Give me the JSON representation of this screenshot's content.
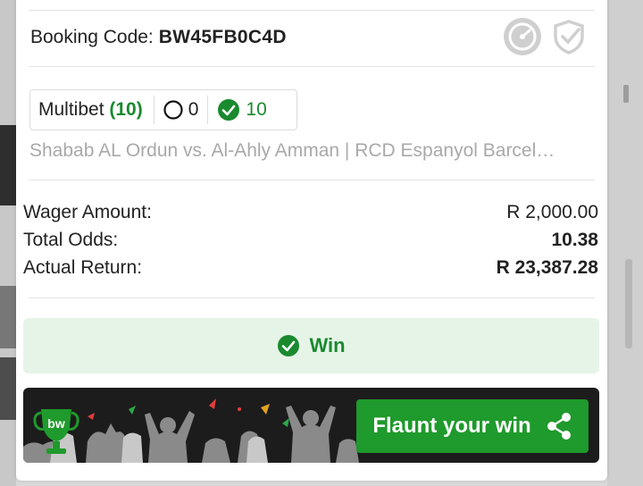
{
  "booking": {
    "label": "Booking Code:",
    "code": "BW45FB0C4D"
  },
  "multibet": {
    "label": "Multibet",
    "count": "(10)",
    "open_count": "0",
    "won_count": "10"
  },
  "matches_text": "Shabab AL Ordun vs. Al-Ahly Amman | RCD Espanyol Barcel…",
  "summary": {
    "wager_label": "Wager Amount:",
    "wager_value": "R 2,000.00",
    "odds_label": "Total Odds:",
    "odds_value": "10.38",
    "return_label": "Actual Return:",
    "return_value": "R 23,387.28"
  },
  "status": {
    "label": "Win"
  },
  "banner": {
    "logo_text": "bw",
    "button_label": "Flaunt your win"
  },
  "colors": {
    "accent_green": "#1a8a2f",
    "win_bg": "#e6f4e7",
    "button_green": "#1f9a2c"
  }
}
